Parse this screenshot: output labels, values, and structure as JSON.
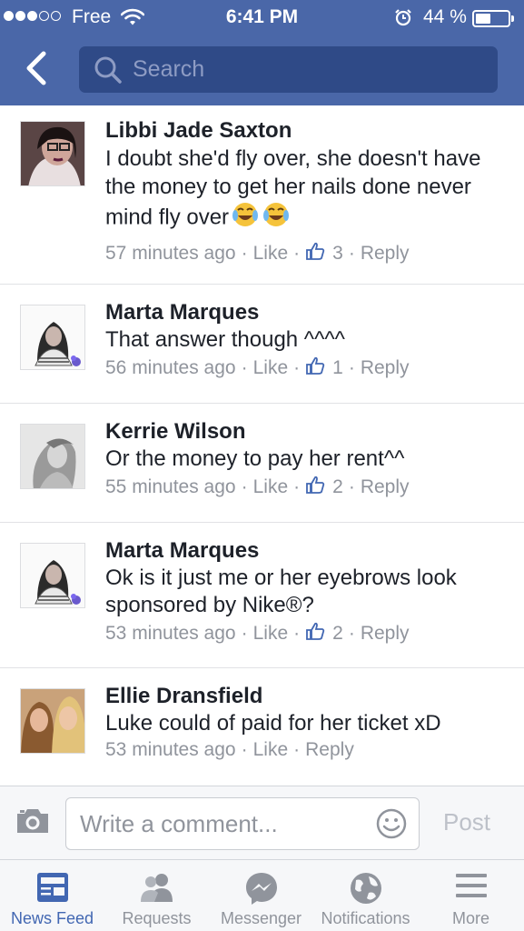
{
  "status_bar": {
    "carrier": "Free",
    "time": "6:41 PM",
    "battery_percent": "44 %",
    "battery_level": 0.44,
    "signal_bars": 3
  },
  "nav": {
    "search_placeholder": "Search",
    "back_icon": "chevron-left-icon",
    "search_icon": "magnifier-icon"
  },
  "comments": [
    {
      "name": "Libbi Jade Saxton",
      "text": "I doubt she'd fly over, she doesn't have the money to get her nails done never mind fly over",
      "emoji": "😂😂",
      "time": "57 minutes ago",
      "like_label": "Like",
      "like_count": "3",
      "reply_label": "Reply"
    },
    {
      "name": "Marta Marques",
      "text": "That answer though ^^^^",
      "time": "56 minutes ago",
      "like_label": "Like",
      "like_count": "1",
      "reply_label": "Reply"
    },
    {
      "name": "Kerrie Wilson",
      "text": "Or the money to pay her rent^^",
      "time": "55 minutes ago",
      "like_label": "Like",
      "like_count": "2",
      "reply_label": "Reply"
    },
    {
      "name": "Marta Marques",
      "text": "Ok is it just me or her eyebrows look sponsored by Nike®?",
      "time": "53 minutes ago",
      "like_label": "Like",
      "like_count": "2",
      "reply_label": "Reply"
    },
    {
      "name": "Ellie Dransfield",
      "text": "Luke could of paid for her ticket xD",
      "time": "53 minutes ago",
      "like_label": "Like",
      "reply_label": "Reply"
    }
  ],
  "composer": {
    "placeholder": "Write a comment...",
    "post_label": "Post"
  },
  "tabs": [
    {
      "label": "News Feed",
      "icon": "news-feed-icon",
      "active": true
    },
    {
      "label": "Requests",
      "icon": "friends-icon",
      "active": false
    },
    {
      "label": "Messenger",
      "icon": "messenger-icon",
      "active": false
    },
    {
      "label": "Notifications",
      "icon": "globe-icon",
      "active": false
    },
    {
      "label": "More",
      "icon": "hamburger-icon",
      "active": false
    }
  ],
  "colors": {
    "brand": "#4a67a8",
    "search_bg": "#2f4a87",
    "active_tab": "#4267b2",
    "meta_gray": "#90949c"
  }
}
